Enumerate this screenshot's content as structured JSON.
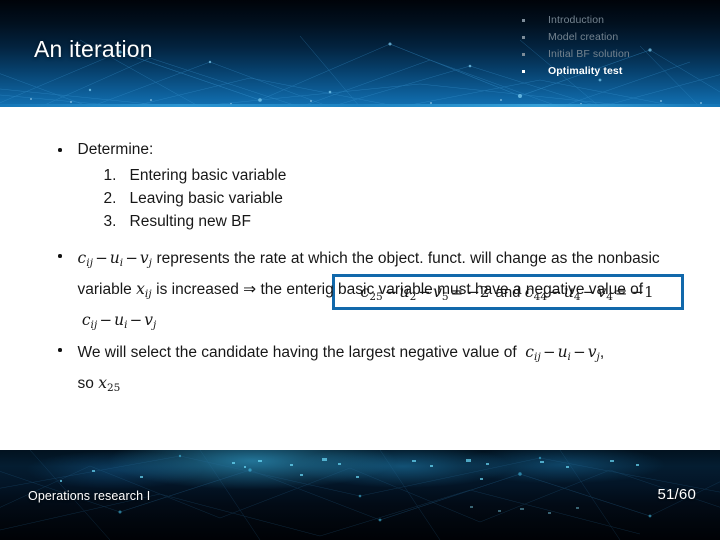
{
  "header": {
    "title": "An iteration",
    "nav": {
      "items": [
        {
          "label": "Introduction",
          "active": false
        },
        {
          "label": "Model creation",
          "active": false
        },
        {
          "label": "Initial BF solution",
          "active": false
        },
        {
          "label": "Optimality test",
          "active": true
        }
      ]
    }
  },
  "body": {
    "bullet1": {
      "heading": "Determine:",
      "steps": [
        {
          "num": "1.",
          "text": "Entering basic variable"
        },
        {
          "num": "2.",
          "text": "Leaving basic variable"
        },
        {
          "num": "3.",
          "text": "Resulting new BF"
        }
      ]
    },
    "formula_box": {
      "text": "c25 − u2 − v5 = −2 and c44 − u4 − v4 = −1",
      "border_color": "#1168ab",
      "parts": {
        "c1": "c",
        "c1sub": "25",
        "u1": "u",
        "u1sub": "2",
        "v1": "v",
        "v1sub": "5",
        "res1": "−2",
        "conj": "and",
        "c2": "c",
        "c2sub": "44",
        "u2": "u",
        "u2sub": "4",
        "v2": "v",
        "v2sub": "4",
        "res2": "−1",
        "minus": "−",
        "equals": "="
      }
    },
    "bullet2": {
      "expr_lead": {
        "c": "c",
        "csub": "ij",
        "u": "u",
        "usub": "i",
        "v": "v",
        "vsub": "j"
      },
      "text_a": "represents the rate at which the object. funct. will change as the",
      "text_b": "nonbasic variable",
      "var_x": {
        "x": "x",
        "xsub": "ij"
      },
      "text_c": "is increased ⇒ the enterig basic variable must have a",
      "text_d": "negative value of",
      "expr_tail": {
        "c": "c",
        "csub": "ij",
        "u": "u",
        "usub": "i",
        "v": "v",
        "vsub": "j"
      }
    },
    "bullet3": {
      "text_a": "We will select the candidate having the largest negative value of",
      "expr": {
        "c": "c",
        "csub": "ij",
        "u": "u",
        "usub": "i",
        "v": "v",
        "vsub": "j"
      },
      "comma": ",",
      "text_b": "so",
      "var_x": {
        "x": "x",
        "xsub": "25"
      }
    },
    "math_symbols": {
      "minus": "−",
      "implies": "⇒"
    }
  },
  "footer": {
    "course": "Operations research I",
    "page": "51/60"
  }
}
